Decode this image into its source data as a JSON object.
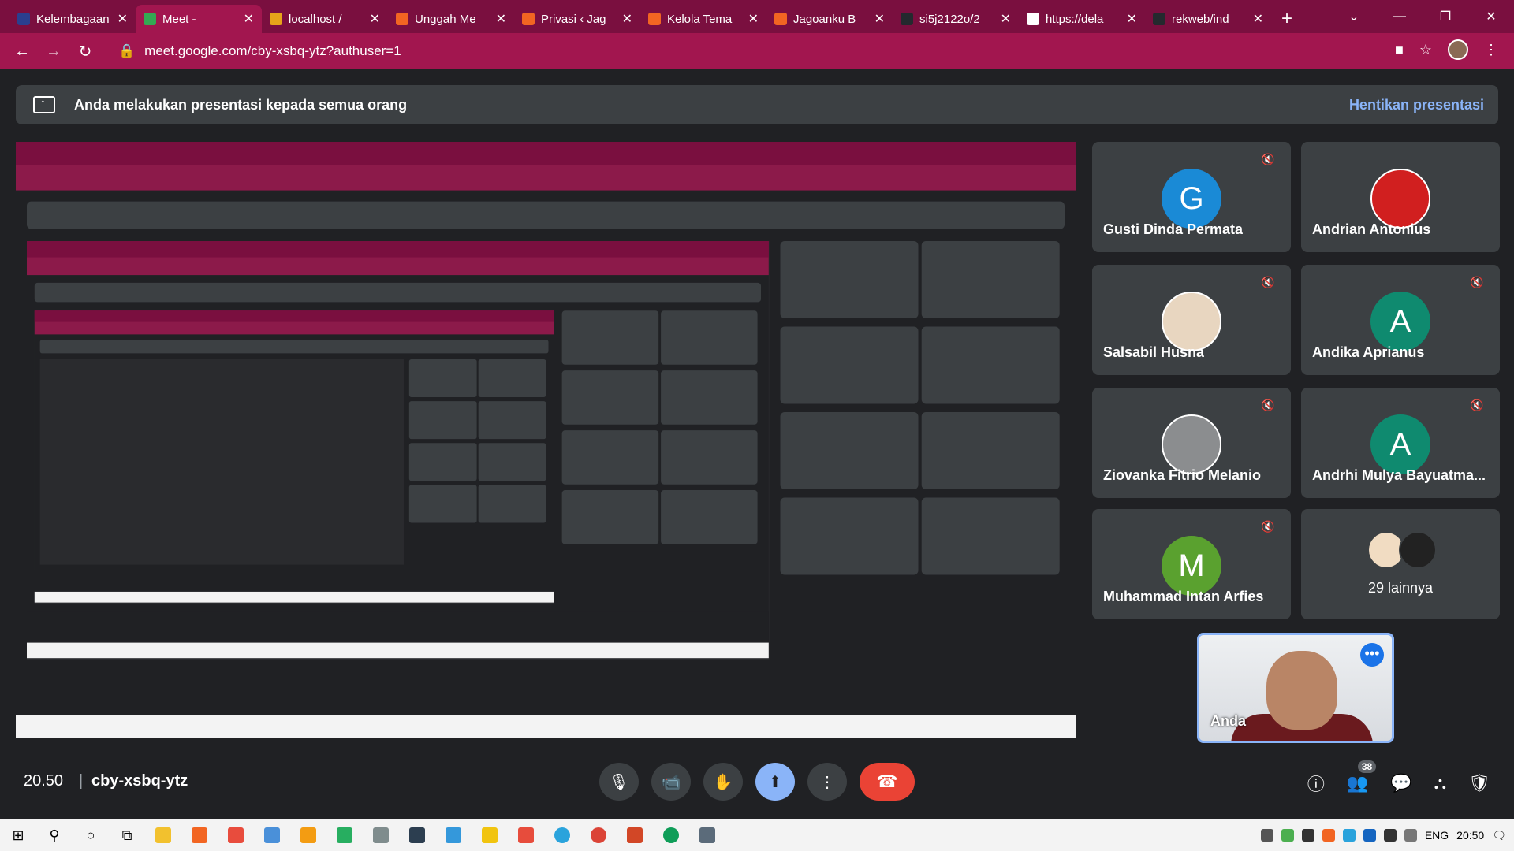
{
  "browser": {
    "tabs": [
      {
        "title": "Kelembagaan",
        "color": "#2a3f8f"
      },
      {
        "title": "Meet - ",
        "color": "#34a853",
        "active": true
      },
      {
        "title": "localhost /",
        "color": "#e6a31a"
      },
      {
        "title": "Unggah Me",
        "color": "#f26522"
      },
      {
        "title": "Privasi ‹ Jag",
        "color": "#f26522"
      },
      {
        "title": "Kelola Tema",
        "color": "#f26522"
      },
      {
        "title": "Jagoanku B",
        "color": "#f26522"
      },
      {
        "title": "si5j2122o/2",
        "color": "#24292e"
      },
      {
        "title": "https://dela",
        "color": "#ffffff"
      },
      {
        "title": "rekweb/ind",
        "color": "#24292e"
      }
    ],
    "url": "meet.google.com/cby-xsbq-ytz?authuser=1"
  },
  "banner": {
    "text": "Anda melakukan presentasi kepada semua orang",
    "stop_label": "Hentikan presentasi"
  },
  "participants": [
    {
      "name": "Gusti Dinda Permata",
      "initial": "G",
      "color": "#1a8ad6",
      "muted": true
    },
    {
      "name": "Andrian Antonius",
      "photo": "red",
      "muted": false
    },
    {
      "name": "Salsabil Husna",
      "photo": "baby",
      "muted": true
    },
    {
      "name": "Andika Aprianus",
      "initial": "A",
      "color": "#0f8a6f",
      "muted": true
    },
    {
      "name": "Ziovanka Fitrio Melanio",
      "photo": "grey",
      "muted": true
    },
    {
      "name": "Andrhi Mulya Bayuatma...",
      "initial": "A",
      "color": "#0f8a6f",
      "muted": true
    },
    {
      "name": "Muhammad Intan Arfies",
      "initial": "M",
      "color": "#5aa12f",
      "muted": true
    }
  ],
  "others": {
    "label": "29 lainnya"
  },
  "self": {
    "name": "Anda"
  },
  "meeting": {
    "time": "20.50",
    "code": "cby-xsbq-ytz",
    "participant_count": "38"
  },
  "taskbar": {
    "lang": "ENG",
    "time": "20:50"
  }
}
